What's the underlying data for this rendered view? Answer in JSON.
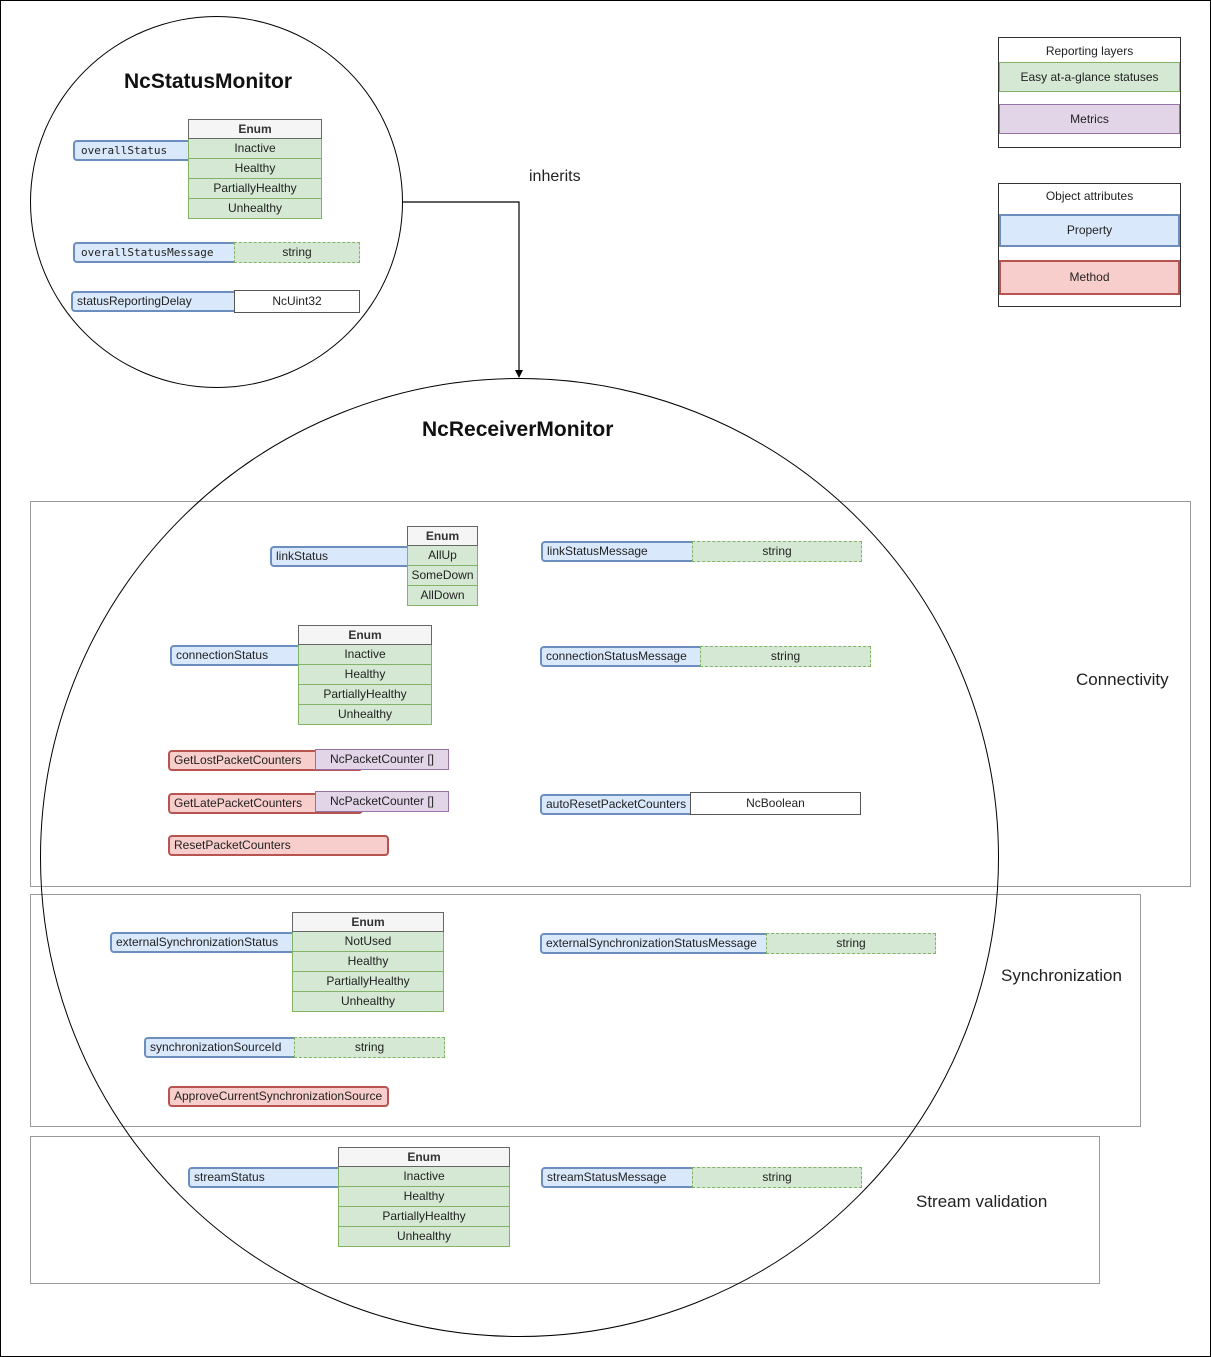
{
  "base_class": {
    "title": "NcStatusMonitor",
    "overallStatus": {
      "name": "overallStatus",
      "enum_header": "Enum",
      "values": [
        "Inactive",
        "Healthy",
        "PartiallyHealthy",
        "Unhealthy"
      ]
    },
    "overallStatusMessage": {
      "name": "overallStatusMessage",
      "type": "string"
    },
    "statusReportingDelay": {
      "name": "statusReportingDelay",
      "type": "NcUint32"
    }
  },
  "inherits_label": "inherits",
  "derived_class": {
    "title": "NcReceiverMonitor",
    "sections": {
      "connectivity": {
        "label": "Connectivity",
        "linkStatus": {
          "name": "linkStatus",
          "enum_header": "Enum",
          "values": [
            "AllUp",
            "SomeDown",
            "AllDown"
          ]
        },
        "linkStatusMessage": {
          "name": "linkStatusMessage",
          "type": "string"
        },
        "connectionStatus": {
          "name": "connectionStatus",
          "enum_header": "Enum",
          "values": [
            "Inactive",
            "Healthy",
            "PartiallyHealthy",
            "Unhealthy"
          ]
        },
        "connectionStatusMessage": {
          "name": "connectionStatusMessage",
          "type": "string"
        },
        "getLostPacketCounters": {
          "name": "GetLostPacketCounters",
          "returns": "NcPacketCounter []"
        },
        "getLatePacketCounters": {
          "name": "GetLatePacketCounters",
          "returns": "NcPacketCounter []"
        },
        "resetPacketCounters": {
          "name": "ResetPacketCounters"
        },
        "autoResetPacketCounters": {
          "name": "autoResetPacketCounters",
          "type": "NcBoolean"
        }
      },
      "synchronization": {
        "label": "Synchronization",
        "externalSynchronizationStatus": {
          "name": "externalSynchronizationStatus",
          "enum_header": "Enum",
          "values": [
            "NotUsed",
            "Healthy",
            "PartiallyHealthy",
            "Unhealthy"
          ]
        },
        "externalSynchronizationStatusMessage": {
          "name": "externalSynchronizationStatusMessage",
          "type": "string"
        },
        "synchronizationSourceId": {
          "name": "synchronizationSourceId",
          "type": "string"
        },
        "approveCurrentSynchronizationSource": {
          "name": "ApproveCurrentSynchronizationSource"
        }
      },
      "stream_validation": {
        "label": "Stream validation",
        "streamStatus": {
          "name": "streamStatus",
          "enum_header": "Enum",
          "values": [
            "Inactive",
            "Healthy",
            "PartiallyHealthy",
            "Unhealthy"
          ]
        },
        "streamStatusMessage": {
          "name": "streamStatusMessage",
          "type": "string"
        }
      }
    }
  },
  "legend": {
    "reporting_layers": {
      "title": "Reporting layers",
      "items": [
        "Easy at-a-glance statuses",
        "Metrics"
      ]
    },
    "object_attributes": {
      "title": "Object attributes",
      "items": [
        "Property",
        "Method"
      ]
    }
  },
  "colors": {
    "status_fill": "#d5e8d4",
    "status_border": "#82b366",
    "metric_fill": "#e1d5e7",
    "metric_border": "#9673a6",
    "property_fill": "#dae8fc",
    "property_border": "#6c8ebf",
    "method_fill": "#f8cecc",
    "method_border": "#b85450"
  }
}
